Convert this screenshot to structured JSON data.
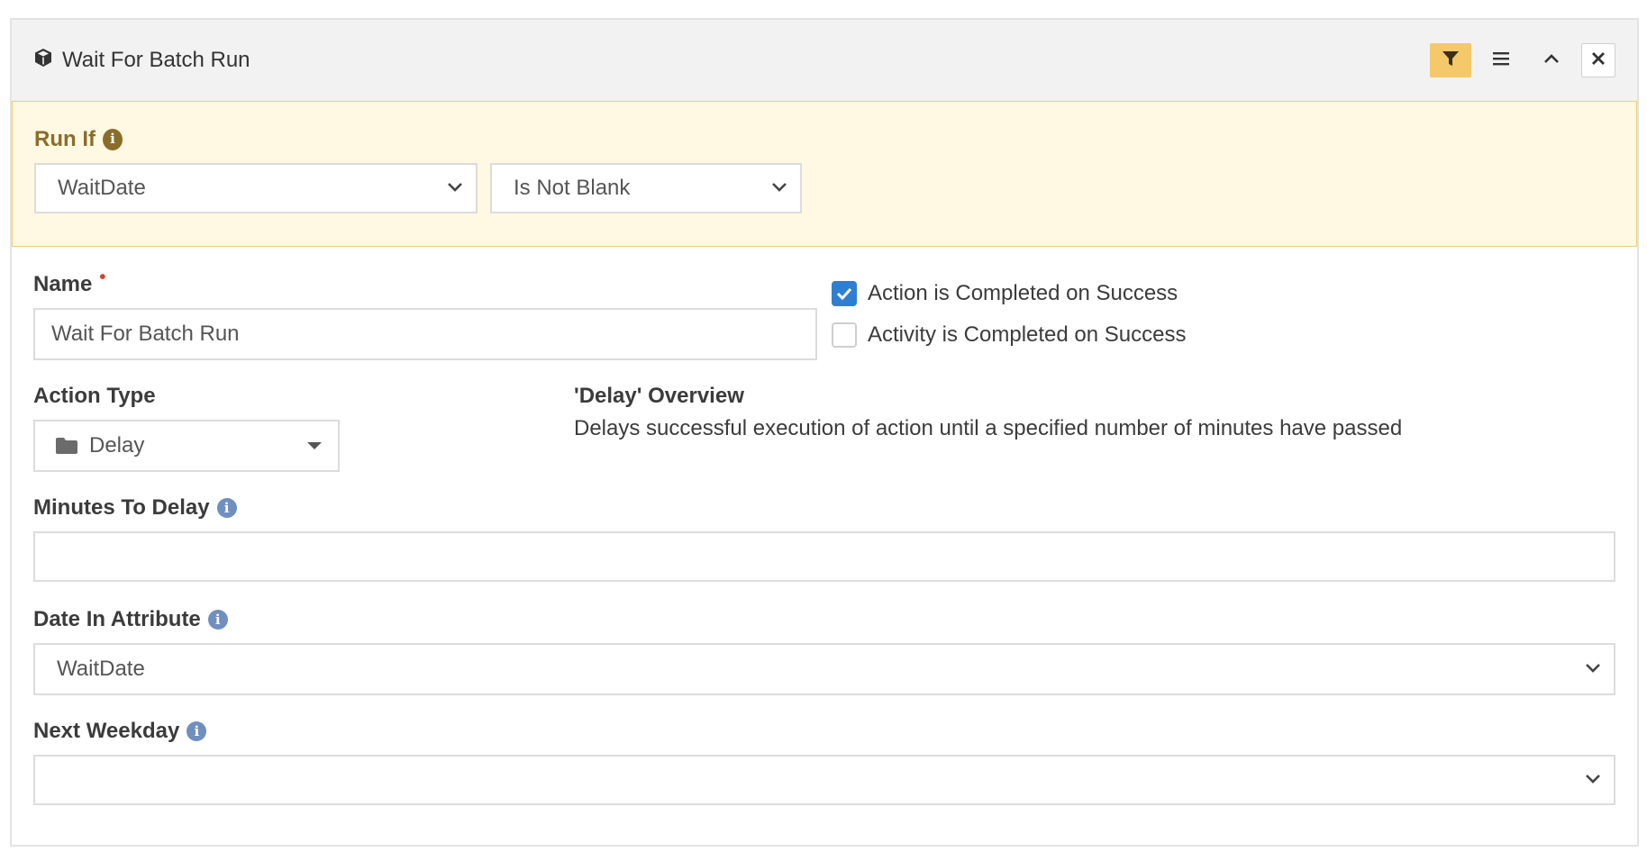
{
  "header": {
    "title": "Wait For Batch Run",
    "icons": [
      "cube-icon",
      "filter-icon",
      "menu-icon",
      "chevron-up-icon",
      "close-icon"
    ],
    "filter_color": "#f5c86a"
  },
  "run_if": {
    "label": "Run If",
    "info_glyph": "i",
    "attribute": "WaitDate",
    "condition": "Is Not Blank",
    "background": "#fff8e3"
  },
  "name": {
    "label": "Name",
    "required_marker": "•",
    "value": "Wait For Batch Run"
  },
  "checkboxes": [
    {
      "label": "Action is Completed on Success",
      "checked": true
    },
    {
      "label": "Activity is Completed on Success",
      "checked": false
    }
  ],
  "action_type": {
    "label": "Action Type",
    "value": "Delay"
  },
  "overview": {
    "title": "'Delay' Overview",
    "description": "Delays successful execution of action until a specified number of minutes have passed"
  },
  "minutes_to_delay": {
    "label": "Minutes To Delay",
    "info_glyph": "i",
    "value": ""
  },
  "date_in_attribute": {
    "label": "Date In Attribute",
    "info_glyph": "i",
    "value": "WaitDate"
  },
  "next_weekday": {
    "label": "Next Weekday",
    "info_glyph": "i",
    "value": ""
  }
}
